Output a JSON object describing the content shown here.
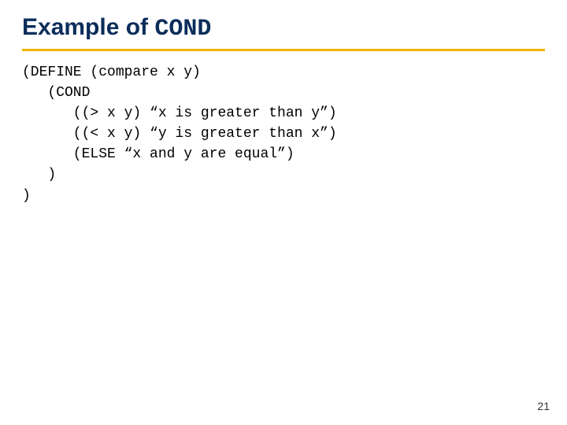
{
  "title": {
    "prefix": "Example of ",
    "code_word": "COND"
  },
  "code": {
    "l1": "(DEFINE (compare x y)",
    "l2": "   (COND",
    "l3": "      ((> x y) “x is greater than y”)",
    "l4": "      ((< x y) “y is greater than x”)",
    "l5": "      (ELSE “x and y are equal”)",
    "l6": "   )",
    "l7": ")"
  },
  "page_number": "21"
}
